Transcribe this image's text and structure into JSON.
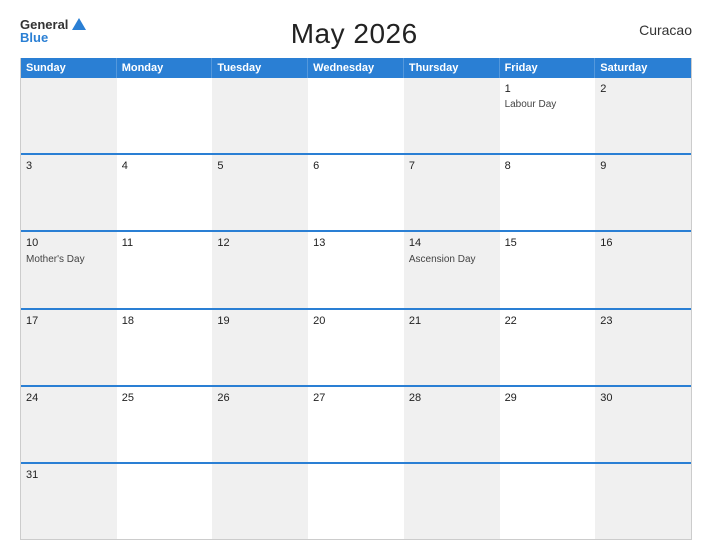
{
  "logo": {
    "general": "General",
    "blue": "Blue"
  },
  "title": "May 2026",
  "country": "Curacao",
  "days_header": [
    "Sunday",
    "Monday",
    "Tuesday",
    "Wednesday",
    "Thursday",
    "Friday",
    "Saturday"
  ],
  "weeks": [
    [
      {
        "num": "",
        "event": ""
      },
      {
        "num": "",
        "event": ""
      },
      {
        "num": "",
        "event": ""
      },
      {
        "num": "",
        "event": ""
      },
      {
        "num": "",
        "event": ""
      },
      {
        "num": "1",
        "event": "Labour Day"
      },
      {
        "num": "2",
        "event": ""
      }
    ],
    [
      {
        "num": "3",
        "event": ""
      },
      {
        "num": "4",
        "event": ""
      },
      {
        "num": "5",
        "event": ""
      },
      {
        "num": "6",
        "event": ""
      },
      {
        "num": "7",
        "event": ""
      },
      {
        "num": "8",
        "event": ""
      },
      {
        "num": "9",
        "event": ""
      }
    ],
    [
      {
        "num": "10",
        "event": "Mother's Day"
      },
      {
        "num": "11",
        "event": ""
      },
      {
        "num": "12",
        "event": ""
      },
      {
        "num": "13",
        "event": ""
      },
      {
        "num": "14",
        "event": "Ascension Day"
      },
      {
        "num": "15",
        "event": ""
      },
      {
        "num": "16",
        "event": ""
      }
    ],
    [
      {
        "num": "17",
        "event": ""
      },
      {
        "num": "18",
        "event": ""
      },
      {
        "num": "19",
        "event": ""
      },
      {
        "num": "20",
        "event": ""
      },
      {
        "num": "21",
        "event": ""
      },
      {
        "num": "22",
        "event": ""
      },
      {
        "num": "23",
        "event": ""
      }
    ],
    [
      {
        "num": "24",
        "event": ""
      },
      {
        "num": "25",
        "event": ""
      },
      {
        "num": "26",
        "event": ""
      },
      {
        "num": "27",
        "event": ""
      },
      {
        "num": "28",
        "event": ""
      },
      {
        "num": "29",
        "event": ""
      },
      {
        "num": "30",
        "event": ""
      }
    ],
    [
      {
        "num": "31",
        "event": ""
      },
      {
        "num": "",
        "event": ""
      },
      {
        "num": "",
        "event": ""
      },
      {
        "num": "",
        "event": ""
      },
      {
        "num": "",
        "event": ""
      },
      {
        "num": "",
        "event": ""
      },
      {
        "num": "",
        "event": ""
      }
    ]
  ]
}
